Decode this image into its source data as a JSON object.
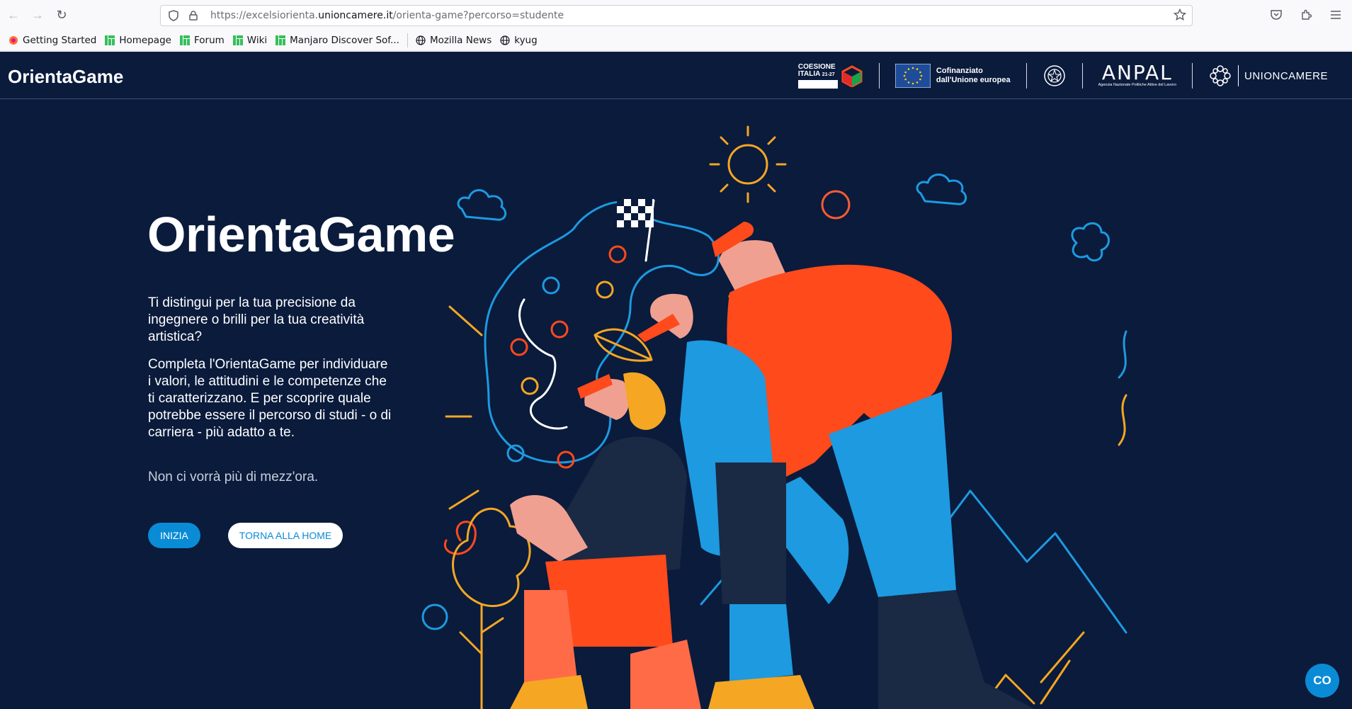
{
  "browser": {
    "url_prefix": "https://excelsiorienta.",
    "url_domain": "unioncamere.it",
    "url_path": "/orienta-game?percorso=studente",
    "bookmarks": [
      {
        "label": "Getting Started"
      },
      {
        "label": "Homepage"
      },
      {
        "label": "Forum"
      },
      {
        "label": "Wiki"
      },
      {
        "label": "Manjaro Discover Sof..."
      },
      {
        "label": "Mozilla News"
      },
      {
        "label": "kyug"
      }
    ]
  },
  "header": {
    "site_title": "OrientaGame",
    "logos": {
      "coesione_line1": "COESIONE",
      "coesione_line2": "ITALIA",
      "coesione_years": "21-27",
      "cofinanziato_line1": "Cofinanziato",
      "cofinanziato_line2": "dall'Unione europea",
      "anpal": "ANPAL",
      "anpal_sub": "Agenzia Nazionale Politiche Attive del Lavoro",
      "unioncamere": "UNIONCAMERE"
    }
  },
  "hero": {
    "title": "OrientaGame",
    "paragraph1": "Ti distingui per la tua precisione da ingegnere o brilli per la tua creatività artistica?",
    "paragraph2": "Completa l'OrientaGame per individuare i valori, le attitudini e le competenze che ti caratterizzano. E per scoprire quale potrebbe essere il percorso di studi - o di carriera - più adatto a te.",
    "note": "Non ci vorrà più di mezz'ora.",
    "start_label": "INIZIA",
    "home_label": "TORNA ALLA HOME"
  },
  "chat": {
    "label": "CO"
  },
  "colors": {
    "page_bg": "#0a1b3c",
    "accent": "#0a8bd6",
    "orange": "#ff4a1c",
    "blue": "#1d9ae0"
  }
}
